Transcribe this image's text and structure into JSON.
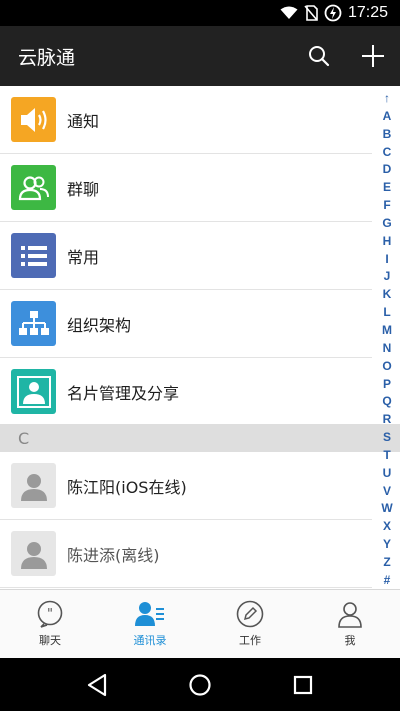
{
  "status_bar": {
    "time": "17:25"
  },
  "app_bar": {
    "title": "云脉通"
  },
  "feature_rows": [
    {
      "label": "通知",
      "icon": "speaker-icon",
      "color": "#F5A623"
    },
    {
      "label": "群聊",
      "icon": "group-chat-icon",
      "color": "#3DB843"
    },
    {
      "label": "常用",
      "icon": "list-icon",
      "color": "#4E6BB5"
    },
    {
      "label": "组织架构",
      "icon": "org-chart-icon",
      "color": "#3D8FDC"
    },
    {
      "label": "名片管理及分享",
      "icon": "business-card-icon",
      "color": "#1FB5A5"
    }
  ],
  "section_header": "C",
  "contacts": [
    {
      "name": "陈江阳(iOS在线)",
      "status": "online"
    },
    {
      "name": "陈进添(离线)",
      "status": "offline"
    }
  ],
  "index_letters": [
    "↑",
    "A",
    "B",
    "C",
    "D",
    "E",
    "F",
    "G",
    "H",
    "I",
    "J",
    "K",
    "L",
    "M",
    "N",
    "O",
    "P",
    "Q",
    "R",
    "S",
    "T",
    "U",
    "V",
    "W",
    "X",
    "Y",
    "Z",
    "#"
  ],
  "bottom_nav": {
    "items": [
      {
        "label": "聊天",
        "icon": "chat-icon"
      },
      {
        "label": "通讯录",
        "icon": "contacts-icon",
        "active": true
      },
      {
        "label": "工作",
        "icon": "work-icon"
      },
      {
        "label": "我",
        "icon": "profile-icon"
      }
    ]
  },
  "colors": {
    "accent": "#1E8FD6",
    "app_bar": "#222222",
    "index": "#2A5FA8"
  }
}
